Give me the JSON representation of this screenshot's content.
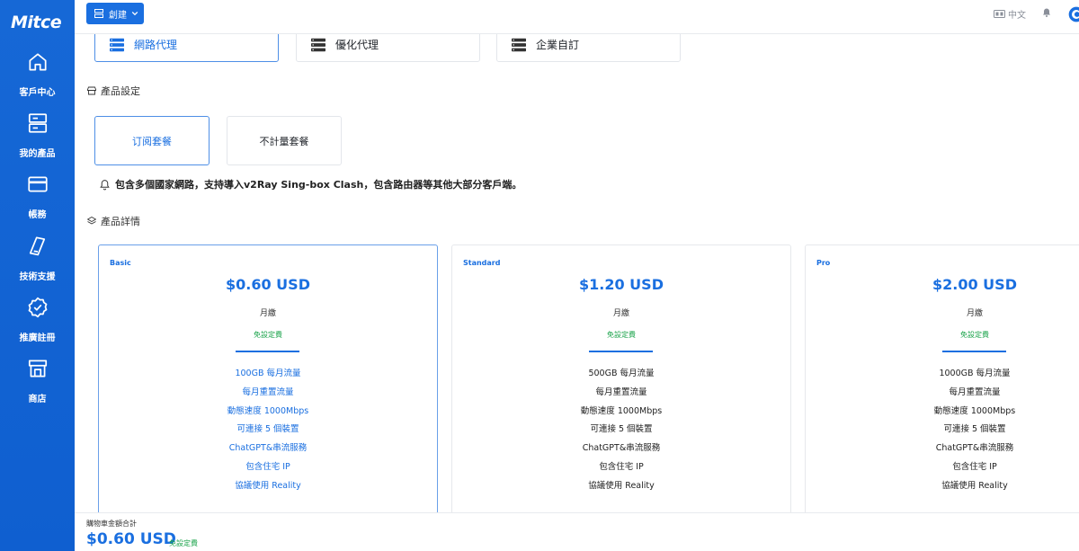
{
  "app": {
    "logo": "Mitce"
  },
  "sidebar": {
    "items": [
      {
        "label": "客戶中心",
        "icon": "home-icon"
      },
      {
        "label": "我的產品",
        "icon": "server-icon"
      },
      {
        "label": "帳務",
        "icon": "credit-card-icon"
      },
      {
        "label": "技術支援",
        "icon": "support-ticket-icon"
      },
      {
        "label": "推廣註冊",
        "icon": "verified-badge-icon"
      },
      {
        "label": "商店",
        "icon": "store-icon"
      }
    ]
  },
  "topbar": {
    "create_label": "創建",
    "language": "中文"
  },
  "categories": [
    {
      "label": "網路代理",
      "active": true
    },
    {
      "label": "優化代理",
      "active": false
    },
    {
      "label": "企業自訂",
      "active": false
    }
  ],
  "product_settings": {
    "title": "產品設定",
    "tabs": [
      {
        "label": "订阅套餐",
        "active": true
      },
      {
        "label": "不計量套餐",
        "active": false
      }
    ],
    "notice": "包含多個國家網路，支持導入v2Ray Sing-box Clash，包含路由器等其他大部分客戶端。"
  },
  "product_details": {
    "title": "產品詳情",
    "packages": [
      {
        "name": "Basic",
        "price": "$0.60 USD",
        "cycle": "月繳",
        "fee": "免設定費",
        "active": true,
        "features": [
          "100GB 每月流量",
          "每月重置流量",
          "動態速度 1000Mbps",
          "可連接 5 個裝置",
          "ChatGPT&串流服務",
          "包含住宅 IP",
          "協議使用 Reality"
        ]
      },
      {
        "name": "Standard",
        "price": "$1.20 USD",
        "cycle": "月繳",
        "fee": "免設定費",
        "active": false,
        "features": [
          "500GB 每月流量",
          "每月重置流量",
          "動態速度 1000Mbps",
          "可連接 5 個裝置",
          "ChatGPT&串流服務",
          "包含住宅 IP",
          "協議使用 Reality"
        ]
      },
      {
        "name": "Pro",
        "price": "$2.00 USD",
        "cycle": "月繳",
        "fee": "免設定費",
        "active": false,
        "features": [
          "1000GB 每月流量",
          "每月重置流量",
          "動態速度 1000Mbps",
          "可連接 5 個裝置",
          "ChatGPT&串流服務",
          "包含住宅 IP",
          "協議使用 Reality"
        ]
      }
    ]
  },
  "cart": {
    "label": "購物車金額合計",
    "total": "$0.60 USD",
    "fee": "免設定費"
  },
  "colors": {
    "brand": "#1a6fe0",
    "sidebar": "#1668d6",
    "success": "#1aa34a"
  }
}
